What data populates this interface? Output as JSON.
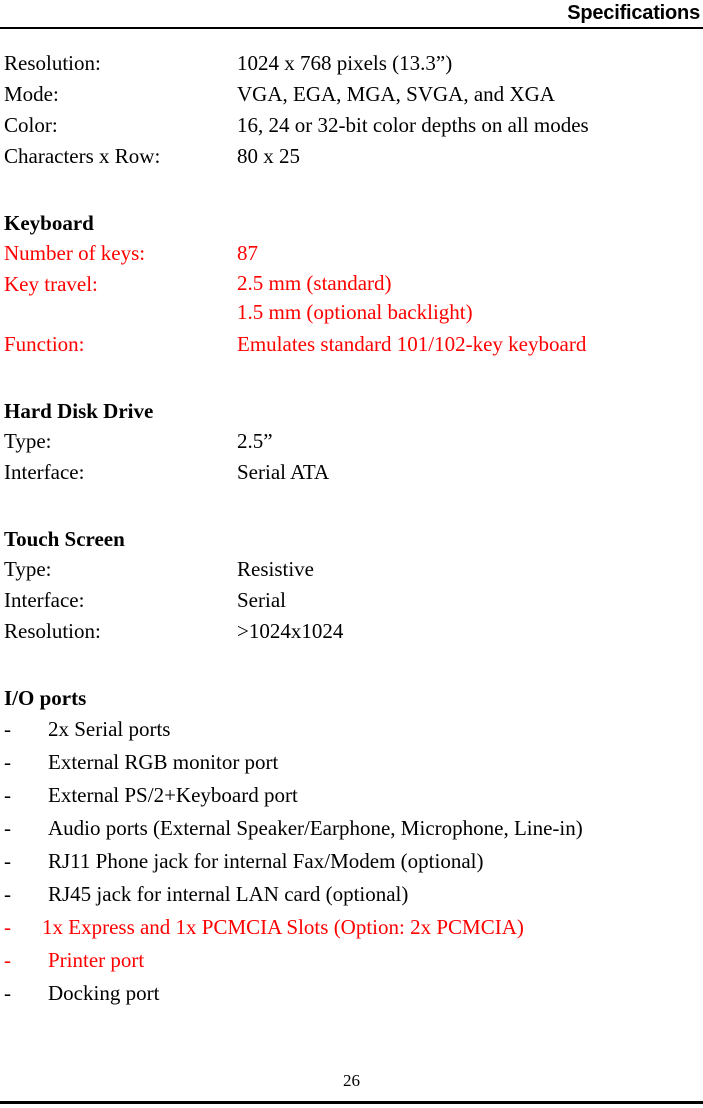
{
  "header": {
    "title": "Specifications"
  },
  "display_specs": [
    {
      "label": "Resolution:",
      "value": "1024 x 768 pixels (13.3”)",
      "color": "#000000"
    },
    {
      "label": "Mode:",
      "value": "VGA, EGA, MGA, SVGA, and XGA",
      "color": "#000000"
    },
    {
      "label": "Color:",
      "value": "16, 24 or 32-bit color depths on all modes",
      "color": "#000000"
    },
    {
      "label": "Characters x Row:",
      "value": "80 x 25",
      "color": "#000000"
    }
  ],
  "sections": [
    {
      "heading": "Keyboard",
      "heading_color": "#000000",
      "rows": [
        {
          "label": "Number of keys:",
          "value": "87",
          "value2": "",
          "color": "#FF0000"
        },
        {
          "label": "Key travel:",
          "value": "2.5 mm (standard)",
          "value2": "1.5 mm (optional backlight)",
          "color": "#FF0000"
        },
        {
          "label": "Function:",
          "value": "Emulates standard 101/102-key keyboard",
          "value2": "",
          "color": "#FF0000"
        }
      ]
    },
    {
      "heading": "Hard Disk Drive",
      "heading_color": "#000000",
      "rows": [
        {
          "label": "Type:",
          "value": "2.5”",
          "value2": "",
          "color": "#000000"
        },
        {
          "label": "Interface:",
          "value": "Serial ATA",
          "value2": "",
          "color": "#000000"
        }
      ]
    },
    {
      "heading": "Touch Screen",
      "heading_color": "#000000",
      "rows": [
        {
          "label": "Type:",
          "value": "Resistive",
          "value2": "",
          "color": "#000000"
        },
        {
          "label": "Interface:",
          "value": "Serial",
          "value2": "",
          "color": "#000000"
        },
        {
          "label": "Resolution:",
          "value": ">1024x1024",
          "value2": "",
          "color": "#000000"
        }
      ]
    }
  ],
  "io_section": {
    "heading": "I/O ports",
    "bullet": "-",
    "items": [
      {
        "text": "2x Serial ports",
        "color": "#000000",
        "indent": "normal"
      },
      {
        "text": "External RGB monitor port",
        "color": "#000000",
        "indent": "normal"
      },
      {
        "text": "External PS/2+Keyboard port",
        "color": "#000000",
        "indent": "normal"
      },
      {
        "text": "Audio ports (External Speaker/Earphone, Microphone, Line-in)",
        "color": "#000000",
        "indent": "normal"
      },
      {
        "text": "RJ11 Phone jack for internal Fax/Modem (optional)",
        "color": "#000000",
        "indent": "normal"
      },
      {
        "text": "RJ45 jack for internal LAN card (optional)",
        "color": "#000000",
        "indent": "normal"
      },
      {
        "text": "1x Express and 1x PCMCIA Slots (Option: 2x PCMCIA)",
        "color": "#FF0000",
        "indent": "tight"
      },
      {
        "text": "Printer port",
        "color": "#FF0000",
        "indent": "tight2"
      },
      {
        "text": "Docking port",
        "color": "#000000",
        "indent": "normal"
      }
    ]
  },
  "footer": {
    "page_number": "26"
  }
}
